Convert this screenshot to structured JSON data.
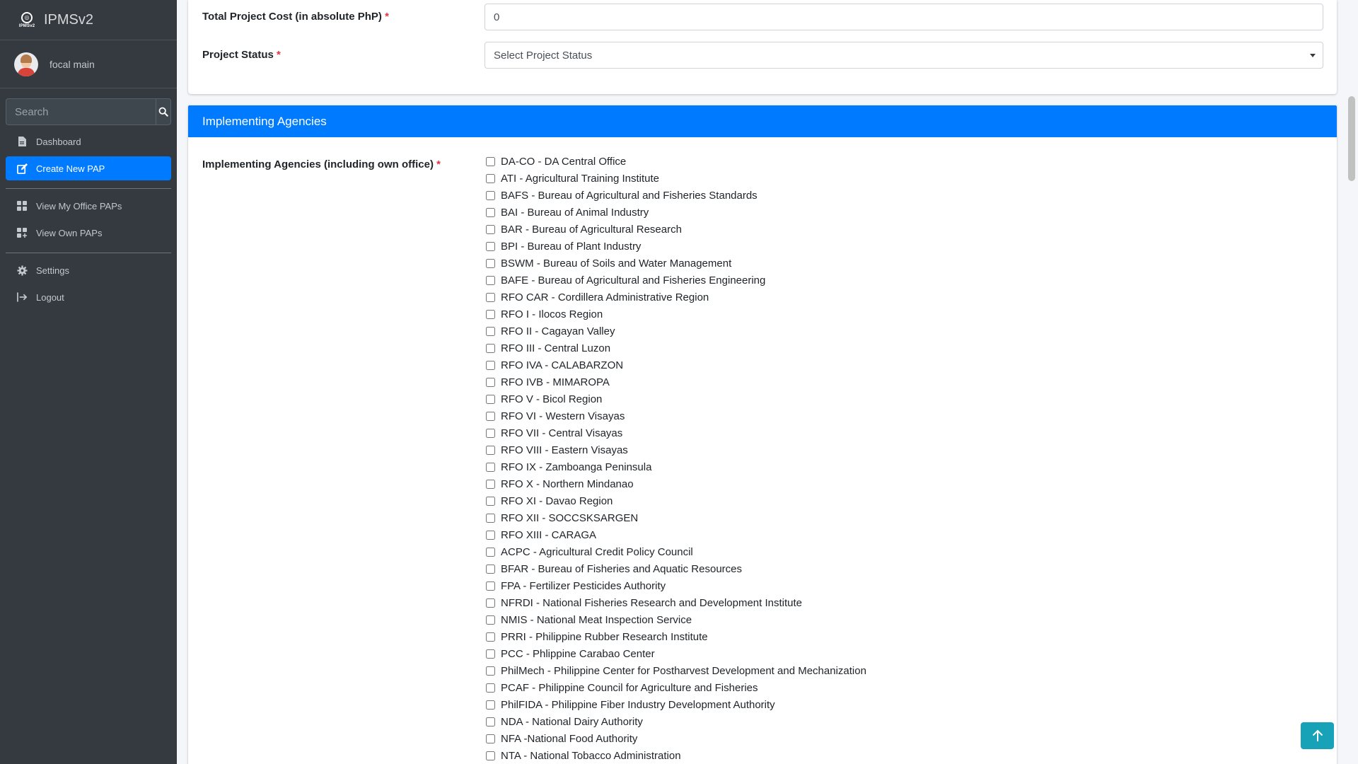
{
  "app": {
    "brand": "IPMSv2",
    "logo_tag": "IPMSv2"
  },
  "user": {
    "name": "focal main"
  },
  "search": {
    "placeholder": "Search"
  },
  "nav": {
    "dashboard": "Dashboard",
    "create_pap": "Create New PAP",
    "view_office": "View My Office PAPs",
    "view_own": "View Own PAPs",
    "settings": "Settings",
    "logout": "Logout"
  },
  "form": {
    "cost_label": "Total Project Cost (in absolute PhP)",
    "cost_value": "0",
    "status_label": "Project Status",
    "status_value": "Select Project Status",
    "required_mark": "*"
  },
  "agencies": {
    "header": "Implementing Agencies",
    "label": "Implementing Agencies (including own office)",
    "items": [
      "DA-CO - DA Central Office",
      "ATI - Agricultural Training Institute",
      "BAFS - Bureau of Agricultural and Fisheries Standards",
      "BAI - Bureau of Animal Industry",
      "BAR - Bureau of Agricultural Research",
      "BPI - Bureau of Plant Industry",
      "BSWM - Bureau of Soils and Water Management",
      "BAFE - Bureau of Agricultural and Fisheries Engineering",
      "RFO CAR - Cordillera Administrative Region",
      "RFO I - Ilocos Region",
      "RFO II - Cagayan Valley",
      "RFO III - Central Luzon",
      "RFO IVA - CALABARZON",
      "RFO IVB - MIMAROPA",
      "RFO V - Bicol Region",
      "RFO VI - Western Visayas",
      "RFO VII - Central Visayas",
      "RFO VIII - Eastern Visayas",
      "RFO IX - Zamboanga Peninsula",
      "RFO X - Northern Mindanao",
      "RFO XI - Davao Region",
      "RFO XII - SOCCSKSARGEN",
      "RFO XIII - CARAGA",
      "ACPC - Agricultural Credit Policy Council",
      "BFAR - Bureau of Fisheries and Aquatic Resources",
      "FPA - Fertilizer Pesticides Authority",
      "NFRDI - National Fisheries Research and Development Institute",
      "NMIS - National Meat Inspection Service",
      "PRRI - Philippine Rubber Research Institute",
      "PCC - Phlippine Carabao Center",
      "PhilMech - Philippine Center for Postharvest Development and Mechanization",
      "PCAF - Philippine Council for Agriculture and Fisheries",
      "PhilFIDA - Philippine Fiber Industry Development Authority",
      "NDA - National Dairy Authority",
      "NFA -National Food Authority",
      "NTA - National Tobacco Administration"
    ]
  },
  "icons": {
    "search": "search-icon",
    "dashboard": "file-icon",
    "create": "edit-icon",
    "grid": "grid-icon",
    "settings": "gear-icon",
    "logout": "logout-icon",
    "to_top": "arrow-up-icon"
  },
  "colors": {
    "sidebar": "#343a40",
    "primary": "#007bff",
    "info": "#17a2b8",
    "required": "#dc3545"
  }
}
